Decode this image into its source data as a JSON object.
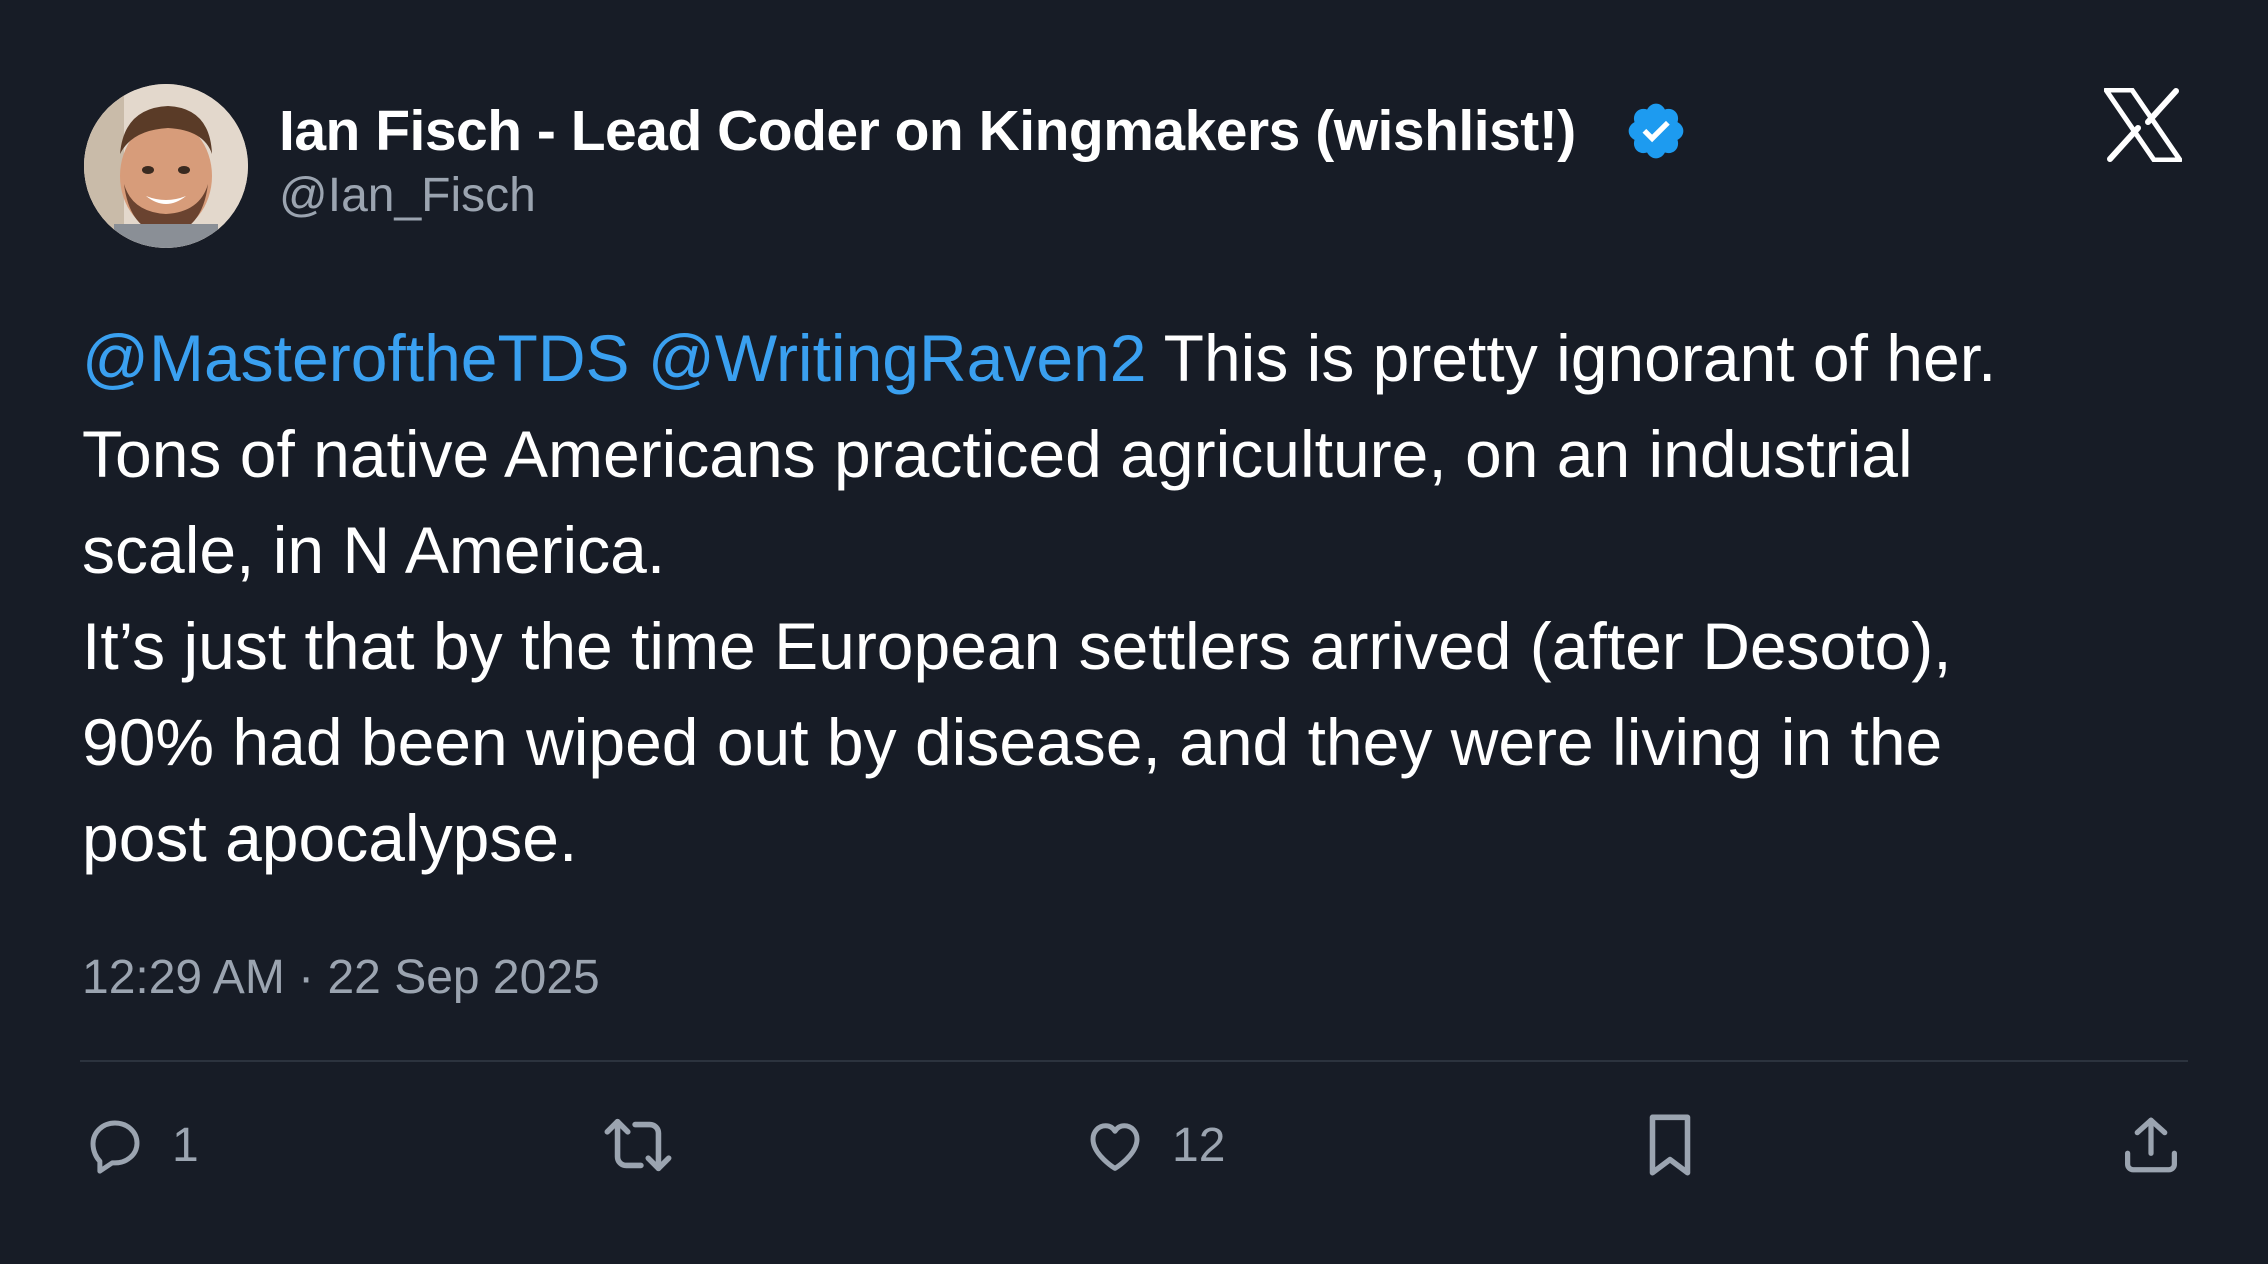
{
  "author": {
    "display_name": "Ian Fisch - Lead Coder on Kingmakers (wishlist!)",
    "handle": "@Ian_Fisch",
    "verified_icon": "verified-badge-icon",
    "avatar": "profile-photo"
  },
  "tweet": {
    "lines": [
      {
        "mention1": "@MasteroftheTDS",
        "mention2": "@WritingRaven2",
        "text": " This is pretty ignorant of her."
      },
      {
        "text": "Tons of native Americans practiced agriculture, on an industrial"
      },
      {
        "text": "scale, in N America."
      },
      {
        "text": "It’s just that by the time European settlers arrived (after Desoto),"
      },
      {
        "text": "90% had been wiped out by disease, and they were living in the"
      },
      {
        "text": "post apocalypse."
      }
    ],
    "timestamp": "12:29 AM · 22 Sep 2025"
  },
  "actions": {
    "reply_count": "1",
    "like_count": "12",
    "icons": [
      "reply-icon",
      "retweet-icon",
      "like-icon",
      "bookmark-icon",
      "share-icon"
    ]
  },
  "brand": {
    "logo": "x-logo-icon",
    "mention_color": "#3aa0f0",
    "background": "#171c26",
    "verified_color": "#1d9bf0"
  }
}
